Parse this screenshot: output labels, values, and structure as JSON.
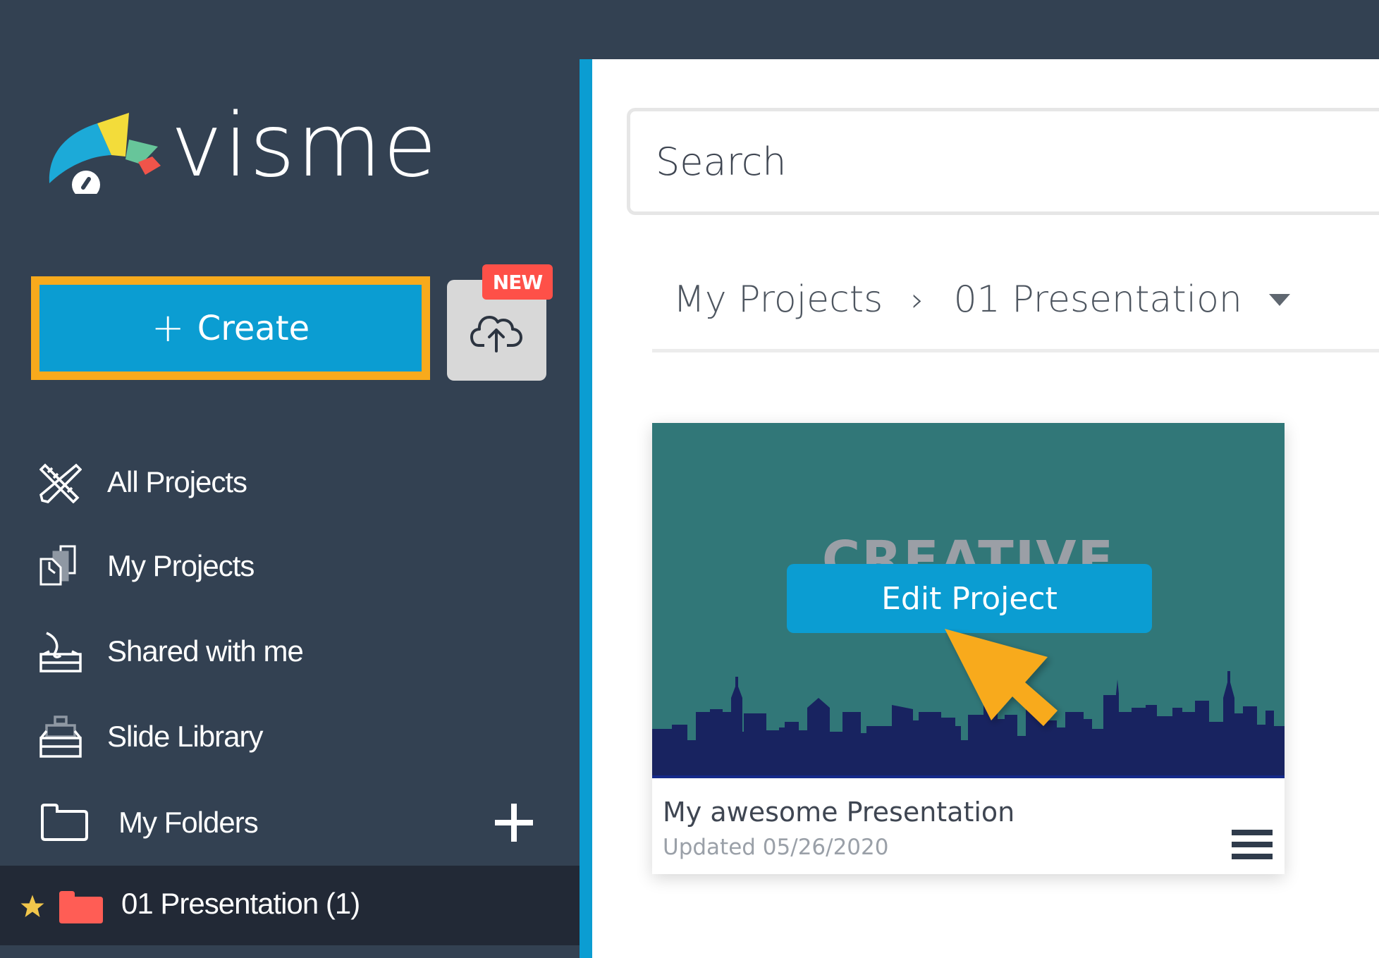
{
  "app": {
    "name": "visme",
    "accent_color": "#0b9dd2",
    "sidebar_color": "#334152",
    "highlight_color": "#f8aa1c"
  },
  "sidebar": {
    "logo_text": "visme",
    "create_label": "Create",
    "create_icon": "plus-icon",
    "upload_icon": "cloud-upload-icon",
    "new_badge": "NEW",
    "items": [
      {
        "label": "All Projects",
        "icon": "pencil-ruler-icon"
      },
      {
        "label": "My Projects",
        "icon": "documents-icon"
      },
      {
        "label": "Shared with me",
        "icon": "shared-inbox-icon"
      },
      {
        "label": "Slide Library",
        "icon": "archive-icon"
      }
    ],
    "folders_label": "My Folders",
    "folders_icon": "folder-outline-icon",
    "add_folder_icon": "plus-icon",
    "active_folder": {
      "label": "01 Presentation (1)",
      "starred": true,
      "color": "#ff5d55"
    }
  },
  "main": {
    "search": {
      "placeholder": "Search",
      "value": ""
    },
    "breadcrumb": [
      {
        "label": "My Projects"
      },
      {
        "label": "01 Presentation"
      }
    ],
    "breadcrumb_separator": "›",
    "projects": [
      {
        "thumbnail_text": "CREATIVE",
        "thumbnail_color": "#317778",
        "hover_action": "Edit Project",
        "title": "My awesome Presentation",
        "updated": "Updated 05/26/2020",
        "menu_icon": "hamburger-menu-icon"
      }
    ]
  }
}
